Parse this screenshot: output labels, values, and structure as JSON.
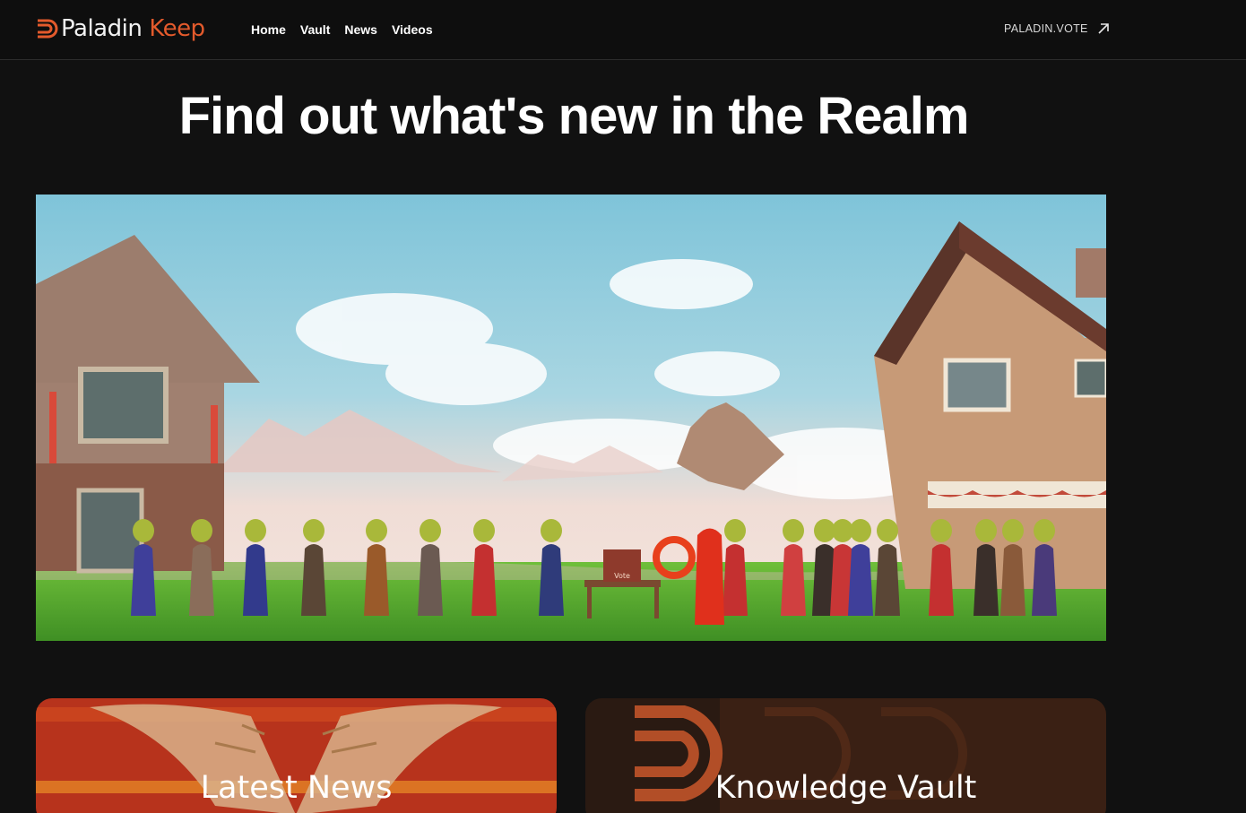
{
  "header": {
    "logo": {
      "word1": "Paladin",
      "word2": "Keep"
    },
    "nav": [
      {
        "label": "Home"
      },
      {
        "label": "Vault"
      },
      {
        "label": "News"
      },
      {
        "label": "Videos"
      }
    ],
    "external_link": {
      "label": "PALADIN.VOTE",
      "icon": "arrow-up-right-icon"
    }
  },
  "main": {
    "title": "Find out what's new in the Realm",
    "hero_image": {
      "poster_sign": "Vote"
    },
    "cards": [
      {
        "label": "Latest News"
      },
      {
        "label": "Knowledge Vault"
      }
    ]
  },
  "colors": {
    "background": "#111111",
    "brand_orange": "#e35a2c",
    "news_card": "#b7331c",
    "vault_card": "#2a1a12"
  }
}
